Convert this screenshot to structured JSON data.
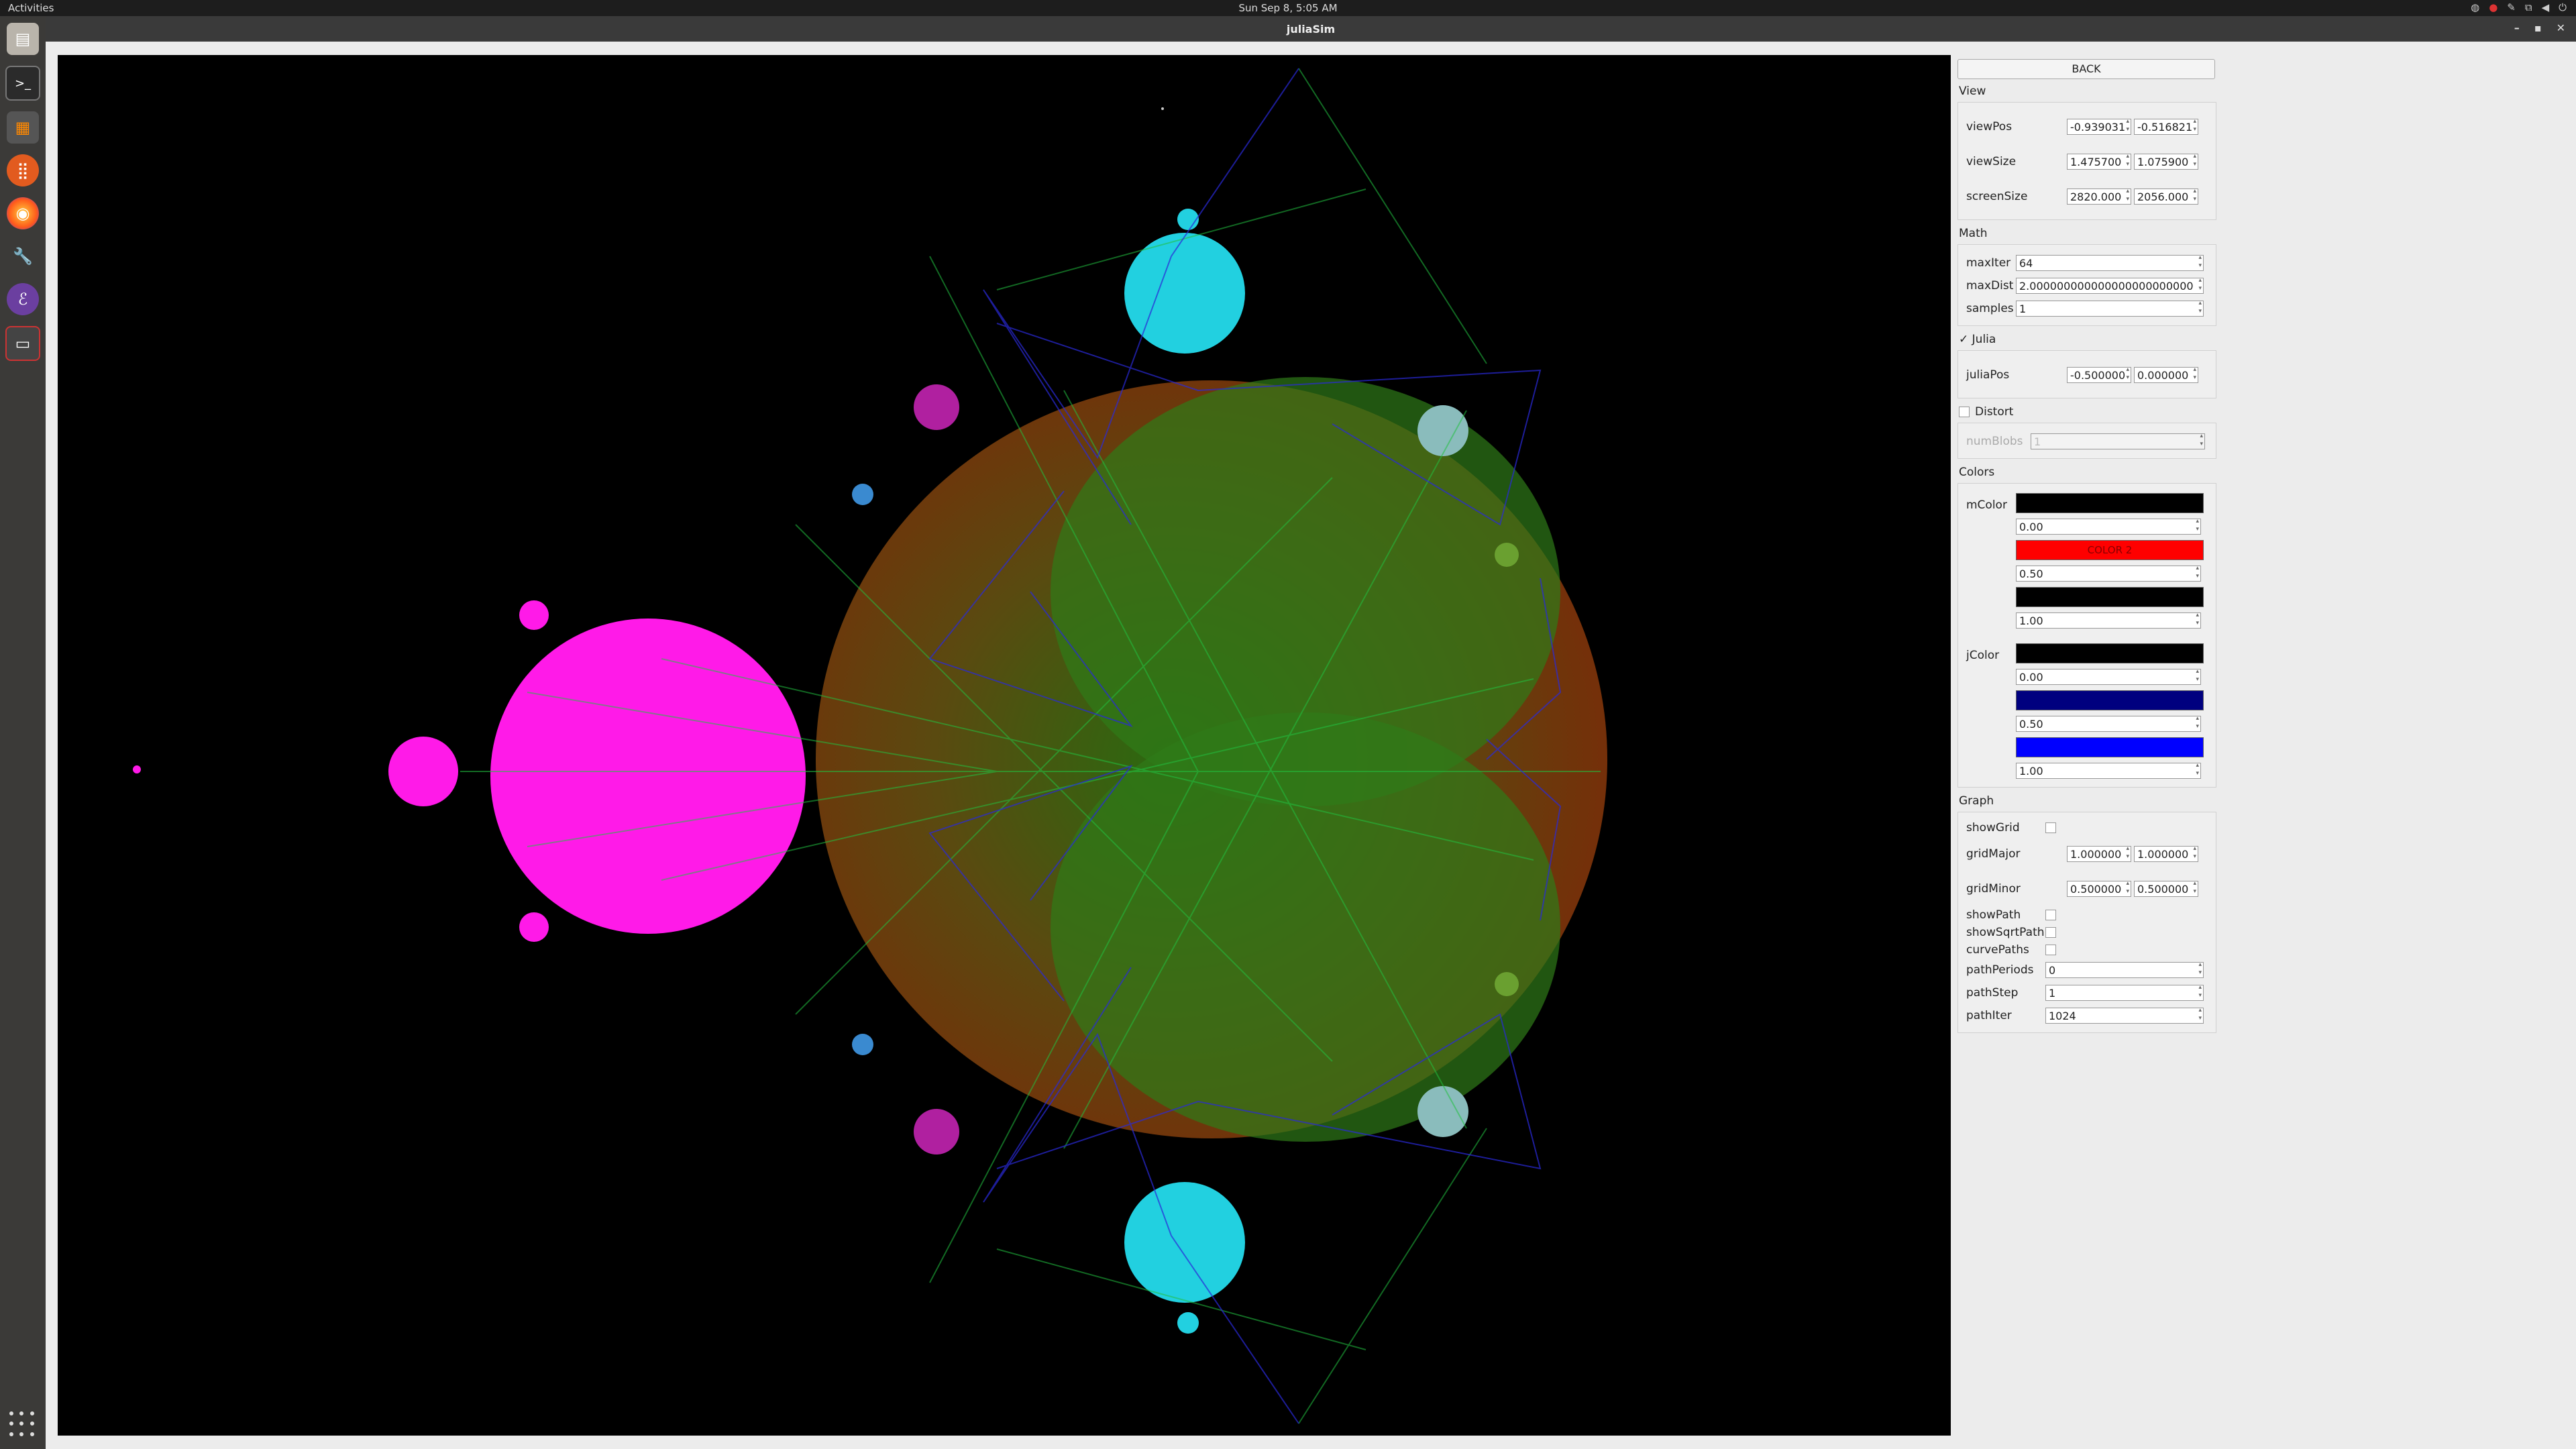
{
  "topbar": {
    "activities": "Activities",
    "clock": "Sun Sep  8,  5:05 AM"
  },
  "window": {
    "title": "juliaSim"
  },
  "dock": {
    "apps": [
      "files-icon",
      "terminal-icon",
      "calculator-icon",
      "app-grid-icon",
      "firefox-icon",
      "drill-icon",
      "emacs-icon",
      "viewer-icon"
    ]
  },
  "panel": {
    "back_label": "BACK",
    "view": {
      "title": "View",
      "viewPos": {
        "label": "viewPos",
        "a": "-0.939031",
        "b": "-0.516821"
      },
      "viewSize": {
        "label": "viewSize",
        "a": "1.475700",
        "b": "1.075900"
      },
      "screenSize": {
        "label": "screenSize",
        "a": "2820.000",
        "b": "2056.000"
      }
    },
    "math": {
      "title": "Math",
      "maxIter": {
        "label": "maxIter",
        "value": "64"
      },
      "maxDist": {
        "label": "maxDist",
        "value": "2.000000000000000000000000"
      },
      "samples": {
        "label": "samples",
        "value": "1"
      }
    },
    "julia": {
      "label": "Julia",
      "checked": "✓",
      "juliaPos": {
        "label": "juliaPos",
        "a": "-0.500000",
        "b": "0.000000"
      }
    },
    "distort": {
      "label": "Distort",
      "numBlobs": {
        "label": "numBlobs",
        "value": "1"
      }
    },
    "colors": {
      "title": "Colors",
      "mColor": {
        "label": "mColor",
        "stops": [
          {
            "color": "#000000",
            "text": "",
            "pos": "0.00"
          },
          {
            "color": "#ff0000",
            "text": "COLOR 2",
            "pos": "0.50"
          },
          {
            "color": "#000000",
            "text": "",
            "pos": "1.00"
          }
        ]
      },
      "jColor": {
        "label": "jColor",
        "stops": [
          {
            "color": "#000000",
            "text": "",
            "pos": "0.00"
          },
          {
            "color": "#00007f",
            "text": "",
            "pos": "0.50"
          },
          {
            "color": "#0000ff",
            "text": "",
            "pos": "1.00"
          }
        ]
      }
    },
    "graph": {
      "title": "Graph",
      "showGrid": {
        "label": "showGrid"
      },
      "gridMajor": {
        "label": "gridMajor",
        "a": "1.000000",
        "b": "1.000000"
      },
      "gridMinor": {
        "label": "gridMinor",
        "a": "0.500000",
        "b": "0.500000"
      },
      "showPath": {
        "label": "showPath"
      },
      "showSqrtPath": {
        "label": "showSqrtPath"
      },
      "curvePaths": {
        "label": "curvePaths"
      },
      "pathPeriods": {
        "label": "pathPeriods",
        "value": "0"
      },
      "pathStep": {
        "label": "pathStep",
        "value": "1"
      },
      "pathIter": {
        "label": "pathIter",
        "value": "1024"
      }
    }
  }
}
